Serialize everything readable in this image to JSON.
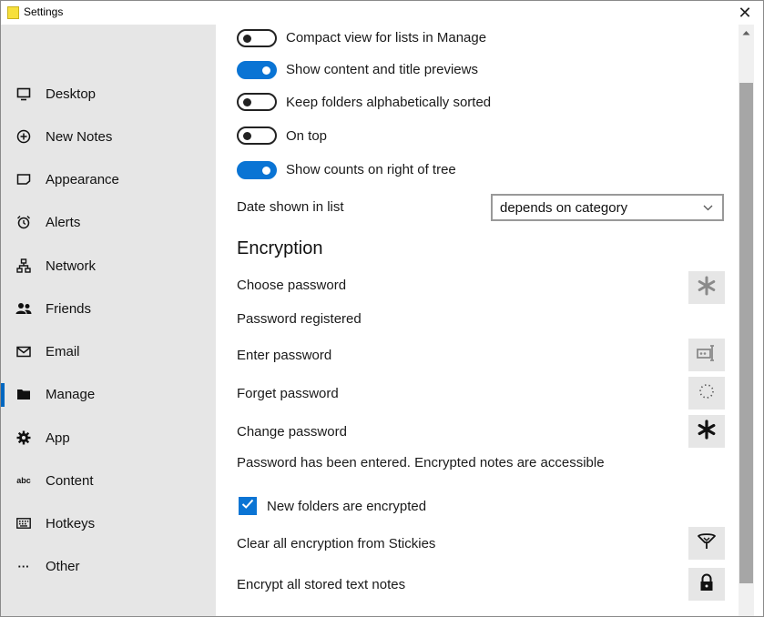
{
  "window": {
    "title": "Settings",
    "close_glyph": "✕"
  },
  "sidebar": {
    "items": [
      {
        "label": "Desktop",
        "icon": "monitor-icon"
      },
      {
        "label": "New Notes",
        "icon": "plus-circle-icon"
      },
      {
        "label": "Appearance",
        "icon": "note-icon"
      },
      {
        "label": "Alerts",
        "icon": "alarm-clock-icon"
      },
      {
        "label": "Network",
        "icon": "network-icon"
      },
      {
        "label": "Friends",
        "icon": "people-icon"
      },
      {
        "label": "Email",
        "icon": "envelope-icon"
      },
      {
        "label": "Manage",
        "icon": "folder-icon",
        "active": true
      },
      {
        "label": "App",
        "icon": "gear-icon"
      },
      {
        "label": "Content",
        "icon": "abc-icon"
      },
      {
        "label": "Hotkeys",
        "icon": "keyboard-icon"
      },
      {
        "label": "Other",
        "icon": "ellipsis-icon"
      }
    ],
    "abc_text": "abc",
    "ellipsis_text": "···"
  },
  "toggles": [
    {
      "label": "Compact view for lists in Manage",
      "on": false
    },
    {
      "label": "Show content and title previews",
      "on": true
    },
    {
      "label": "Keep folders alphabetically sorted",
      "on": false
    },
    {
      "label": "On top",
      "on": false
    },
    {
      "label": "Show counts on right of tree",
      "on": true
    }
  ],
  "date_shown": {
    "label": "Date shown in list",
    "value": "depends on category"
  },
  "encryption": {
    "heading": "Encryption",
    "choose_password": "Choose password",
    "password_registered": "Password registered",
    "enter_password": "Enter password",
    "forget_password": "Forget password",
    "change_password": "Change password",
    "status": "Password has been entered.  Encrypted notes are accessible",
    "new_folders_encrypted": "New folders are encrypted",
    "new_folders_checked": true,
    "clear_all": "Clear all encryption from Stickies",
    "encrypt_all": "Encrypt all stored text notes"
  },
  "colors": {
    "accent": "#0a74d4",
    "sidebar_bg": "#e6e6e6",
    "active_bar": "#0067c0"
  }
}
